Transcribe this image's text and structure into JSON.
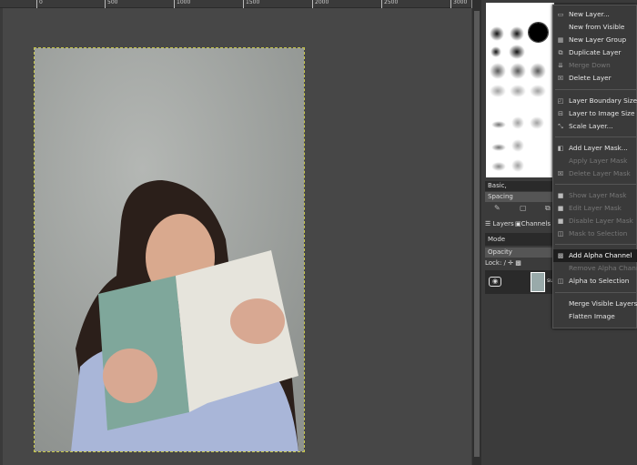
{
  "ruler": {
    "labels": [
      "0",
      "500",
      "1000",
      "1500",
      "2000",
      "2500",
      "3000"
    ]
  },
  "brushes": {
    "preset": "Basic,",
    "spacing_label": "Spacing"
  },
  "layers_panel": {
    "tabs": [
      "Layers",
      "Channels"
    ],
    "mode_label": "Mode",
    "opacity_label": "Opacity",
    "lock_label": "Lock:",
    "layer_name_fragment": "su"
  },
  "menu": {
    "items": [
      {
        "label": "New Layer...",
        "icon": "new-layer-icon",
        "enabled": true
      },
      {
        "label": "New from Visible",
        "icon": "",
        "enabled": true
      },
      {
        "label": "New Layer Group",
        "icon": "layer-group-icon",
        "enabled": true
      },
      {
        "label": "Duplicate Layer",
        "icon": "duplicate-icon",
        "enabled": true
      },
      {
        "label": "Merge Down",
        "icon": "merge-down-icon",
        "enabled": false
      },
      {
        "label": "Delete Layer",
        "icon": "delete-icon",
        "enabled": true
      },
      {
        "label": "Layer Boundary Size...",
        "icon": "boundary-icon",
        "enabled": true
      },
      {
        "label": "Layer to Image Size",
        "icon": "to-image-size-icon",
        "enabled": true
      },
      {
        "label": "Scale Layer...",
        "icon": "scale-icon",
        "enabled": true
      },
      {
        "label": "Add Layer Mask...",
        "icon": "add-mask-icon",
        "enabled": true
      },
      {
        "label": "Apply Layer Mask",
        "icon": "",
        "enabled": false
      },
      {
        "label": "Delete Layer Mask",
        "icon": "delete-icon",
        "enabled": false
      },
      {
        "label": "Show Layer Mask",
        "icon": "checkbox-icon",
        "enabled": false
      },
      {
        "label": "Edit Layer Mask",
        "icon": "checkbox-icon",
        "enabled": false
      },
      {
        "label": "Disable Layer Mask",
        "icon": "checkbox-icon",
        "enabled": false
      },
      {
        "label": "Mask to Selection",
        "icon": "mask-selection-icon",
        "enabled": false
      },
      {
        "label": "Add Alpha Channel",
        "icon": "alpha-icon",
        "enabled": true,
        "highlighted": true
      },
      {
        "label": "Remove Alpha Channel",
        "icon": "",
        "enabled": false
      },
      {
        "label": "Alpha to Selection",
        "icon": "alpha-selection-icon",
        "enabled": true
      },
      {
        "label": "Merge Visible Layers...",
        "icon": "",
        "enabled": true
      },
      {
        "label": "Flatten Image",
        "icon": "",
        "enabled": true
      }
    ]
  }
}
